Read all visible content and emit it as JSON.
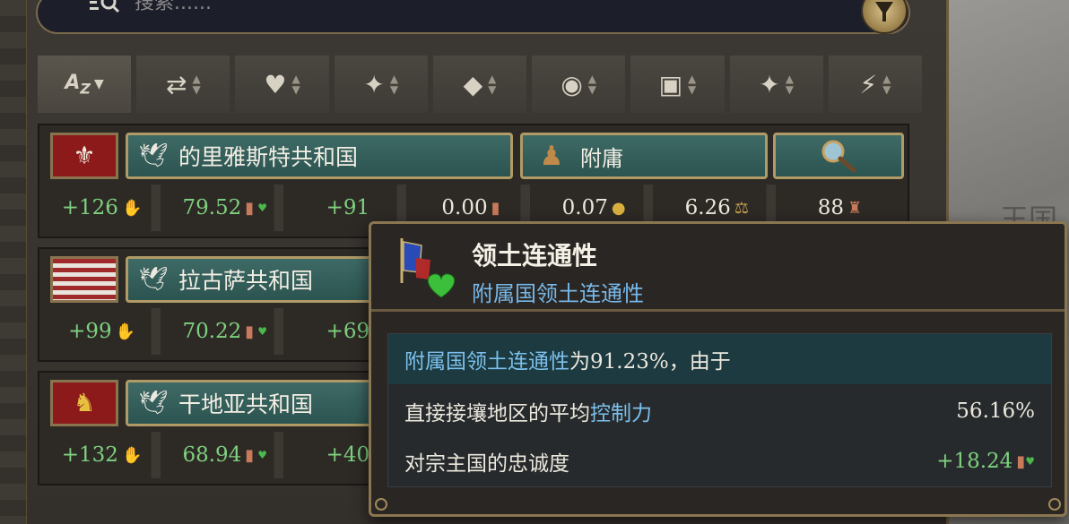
{
  "search": {
    "placeholder": "搜索......"
  },
  "sort_bar": {
    "buttons": [
      {
        "icon": "az-sort-icon",
        "glyph": "AZ"
      },
      {
        "icon": "diplomacy-icon",
        "glyph": "⇄"
      },
      {
        "icon": "heart-icon",
        "glyph": "♥"
      },
      {
        "icon": "star-icon",
        "glyph": "✦"
      },
      {
        "icon": "trade-icon",
        "glyph": "◆"
      },
      {
        "icon": "coins-icon",
        "glyph": "◉"
      },
      {
        "icon": "territory-icon",
        "glyph": "▣"
      },
      {
        "icon": "star-icon",
        "glyph": "✦"
      },
      {
        "icon": "lightning-icon",
        "glyph": "⚡"
      }
    ]
  },
  "rows": [
    {
      "name": "的里雅斯特共和国",
      "subject_type": "附庸",
      "stats": [
        "+126",
        "79.52",
        "+91",
        "0.00",
        "0.07",
        "6.26",
        "88"
      ]
    },
    {
      "name": "拉古萨共和国",
      "stats": [
        "+99",
        "70.22",
        "+69"
      ]
    },
    {
      "name": "干地亚共和国",
      "stats": [
        "+132",
        "68.94",
        "+40"
      ]
    }
  ],
  "tooltip": {
    "title": "领土连通性",
    "subtitle": "附属国领土连通性",
    "summary_highlight": "附属国领土连通性",
    "summary_rest": "为91.23%，由于",
    "line1_label_a": "直接接壤地区的平均",
    "line1_label_b": "控制力",
    "line1_value": "56.16%",
    "line2_label": "对宗主国的忠诚度",
    "line2_value": "+18.24"
  },
  "map": {
    "label": "王国"
  },
  "colors": {
    "positive": "#7ed07e",
    "highlight_blue": "#78b8e8",
    "teal_button": "#2c5450",
    "gold_border": "#b09a66"
  }
}
